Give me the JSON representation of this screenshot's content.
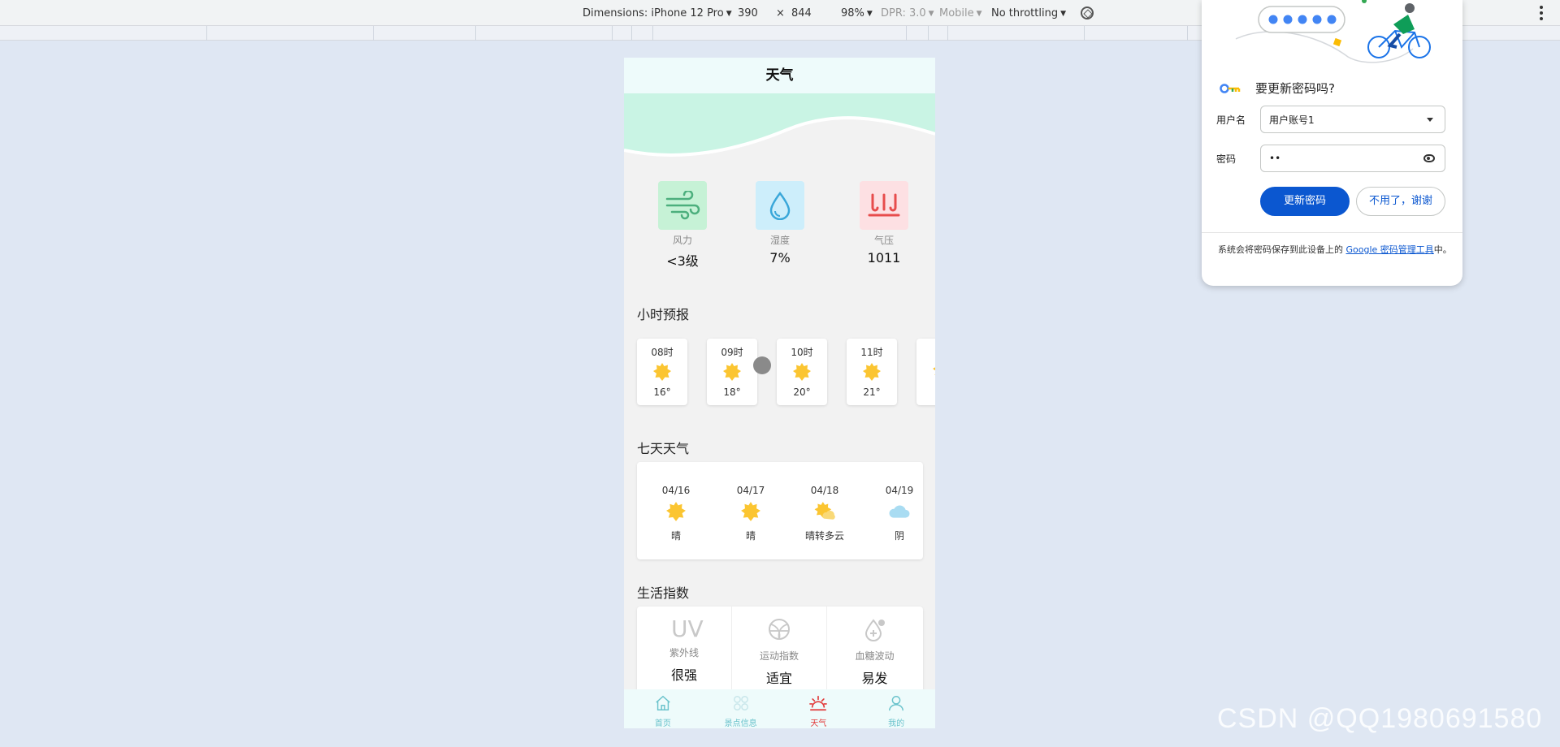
{
  "devtools": {
    "dimensions_label": "Dimensions: iPhone 12 Pro",
    "width": "390",
    "times": "×",
    "height": "844",
    "zoom": "98%",
    "dpr": "DPR: 3.0",
    "mode": "Mobile",
    "throttling": "No throttling"
  },
  "phone": {
    "header_title": "天气",
    "stats": [
      {
        "label": "风力",
        "value": "<3级",
        "icon": "wind-icon",
        "tile_color": "#c6f2d6",
        "icon_color": "#4caf7d"
      },
      {
        "label": "湿度",
        "value": "7%",
        "icon": "droplet-icon",
        "tile_color": "#cdeefb",
        "icon_color": "#3aa7d9"
      },
      {
        "label": "气压",
        "value": "1011",
        "icon": "pressure-icon",
        "tile_color": "#fde0e3",
        "icon_color": "#e74c4c"
      }
    ],
    "hourly_title": "小时预报",
    "hourly": [
      {
        "time": "08时",
        "temp": "16°"
      },
      {
        "time": "09时",
        "temp": "18°"
      },
      {
        "time": "10时",
        "temp": "20°"
      },
      {
        "time": "11时",
        "temp": "21°"
      },
      {
        "time": "1",
        "temp": ""
      }
    ],
    "daily_title": "七天天气",
    "daily": [
      {
        "date": "04/16",
        "cond": "晴",
        "icon": "sun-icon"
      },
      {
        "date": "04/17",
        "cond": "晴",
        "icon": "sun-icon"
      },
      {
        "date": "04/18",
        "cond": "晴转多云",
        "icon": "partly-cloudy-icon"
      },
      {
        "date": "04/19",
        "cond": "阴",
        "icon": "cloud-icon"
      }
    ],
    "life_title": "生活指数",
    "life": [
      {
        "label": "紫外线",
        "value": "很强",
        "icon": "uv-icon",
        "icon_text": "UV"
      },
      {
        "label": "运动指数",
        "value": "适宜",
        "icon": "ball-icon"
      },
      {
        "label": "血糖波动",
        "value": "易发",
        "icon": "drop-plus-icon"
      }
    ],
    "tabs": [
      {
        "label": "首页",
        "icon": "home-icon",
        "active": false
      },
      {
        "label": "景点信息",
        "icon": "grid-icon",
        "active": false
      },
      {
        "label": "天气",
        "icon": "weather-icon",
        "active": true
      },
      {
        "label": "我的",
        "icon": "user-icon",
        "active": false
      }
    ],
    "accent_color": "#e23a3a",
    "tab_color": "#6bc3cc"
  },
  "password_popup": {
    "title": "要更新密码吗?",
    "username_label": "用户名",
    "username_value": "用户账号1",
    "password_label": "密码",
    "password_value": "••",
    "update_button": "更新密码",
    "decline_button": "不用了，谢谢",
    "footer_text": "系统会将密码保存到此设备上的 ",
    "footer_link": "Google 密码管理工具",
    "footer_end": "中。",
    "accent_color": "#0b57d0"
  },
  "watermark": "CSDN @QQ1980691580"
}
